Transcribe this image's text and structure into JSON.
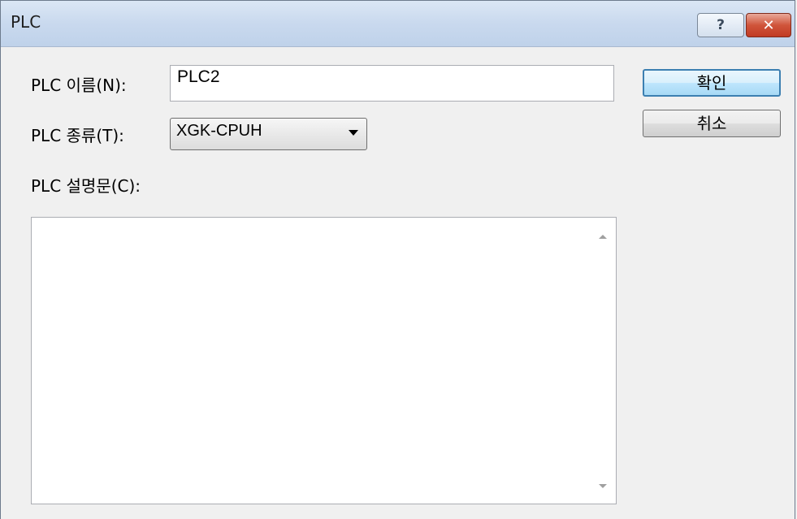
{
  "window": {
    "title": "PLC",
    "help_glyph": "?",
    "close_glyph": "✕"
  },
  "form": {
    "name_label": "PLC 이름(N):",
    "name_value": "PLC2",
    "type_label": "PLC 종류(T):",
    "type_value": "XGK-CPUH",
    "desc_label": "PLC 설명문(C):",
    "desc_value": ""
  },
  "buttons": {
    "ok_label": "확인",
    "cancel_label": "취소"
  },
  "icons": {
    "help": "help-icon",
    "close": "close-icon",
    "dropdown": "chevron-down-icon",
    "scroll_up": "scroll-up-icon",
    "scroll_down": "scroll-down-icon"
  },
  "colors": {
    "titlebar": "#c9d9ee",
    "close_button": "#c94a31",
    "default_button_border": "#3c7fb1"
  }
}
